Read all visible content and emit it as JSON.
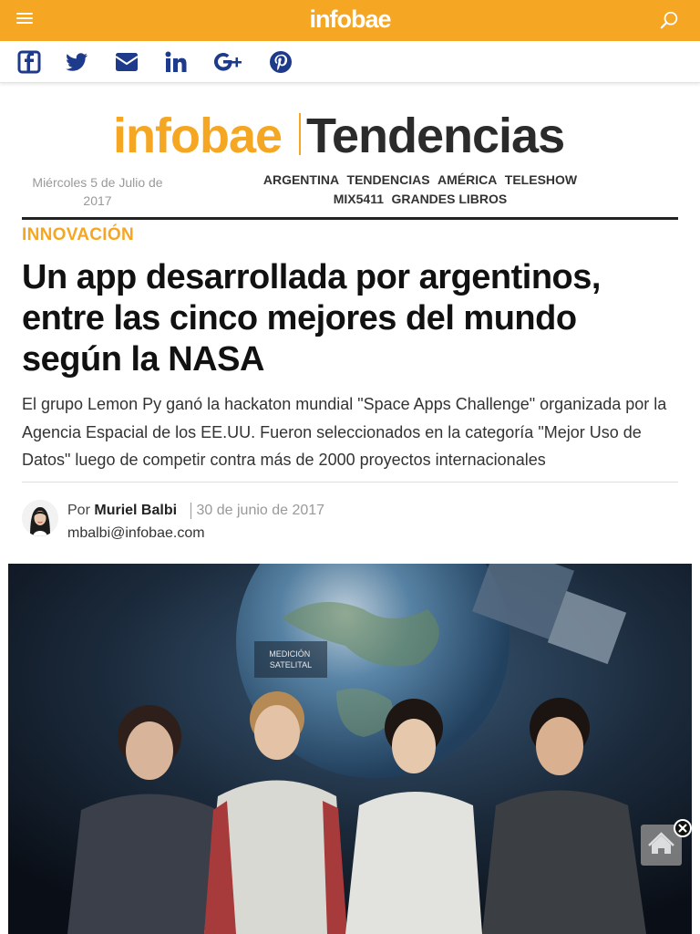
{
  "header": {
    "logo": "infobae",
    "menu_icon": "hamburger-menu-icon",
    "search_icon": "search-icon",
    "brand_color": "#f5a623"
  },
  "share": {
    "icons": [
      "facebook-icon",
      "twitter-icon",
      "email-icon",
      "linkedin-icon",
      "google-plus-icon",
      "pinterest-icon"
    ],
    "color": "#1e3a8a"
  },
  "masthead": {
    "brand": "infobae",
    "section": "Tendencias"
  },
  "date": "Miércoles 5 de Julio de 2017",
  "nav": {
    "items": [
      "ARGENTINA",
      "TENDENCIAS",
      "AMÉRICA",
      "TELESHOW",
      "MIX5411",
      "GRANDES LIBROS"
    ]
  },
  "article": {
    "section": "INNOVACIÓN",
    "title": "Un app desarrollada por argentinos, entre las cinco mejores del mundo según la NASA",
    "summary": "El grupo Lemon Py ganó la hackaton mundial \"Space Apps Challenge\" organizada por la Agencia Espacial de los EE.UU. Fueron seleccionados en la categoría \"Mejor Uso de Datos\" luego de competir contra más de 2000 proyectos internacionales",
    "byline_prefix": "Por",
    "author": "Muriel Balbi",
    "date": "30 de junio de 2017",
    "email": "mbalbi@infobae.com",
    "photo_screen_text": "MEDICIÓN SATELITAL"
  },
  "floating": {
    "home_icon": "home-icon",
    "close_icon": "close-icon"
  }
}
